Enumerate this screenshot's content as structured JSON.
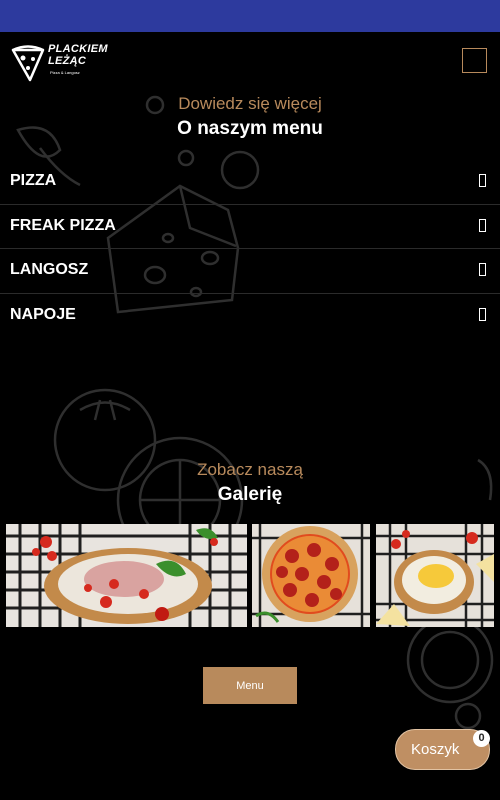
{
  "header": {
    "logo_title_line1": "PLACKIEM",
    "logo_title_line2": "LEŻĄC",
    "logo_subtitle": "Pizza & Langosz",
    "menu_toggle_icon": "",
    "menu_toggle_icon_name": "menu-icon"
  },
  "menu_section": {
    "subtitle": "Dowiedz się więcej",
    "title": "O naszym menu",
    "items": [
      {
        "label": "PIZZA",
        "arrow": ""
      },
      {
        "label": "FREAK PIZZA",
        "arrow": ""
      },
      {
        "label": "LANGOSZ",
        "arrow": ""
      },
      {
        "label": "NAPOJE",
        "arrow": ""
      }
    ]
  },
  "gallery_section": {
    "subtitle": "Zobacz naszą",
    "title": "Galerię"
  },
  "menu_button": {
    "label": "Menu"
  },
  "cart": {
    "label": "Koszyk",
    "icon": "",
    "count": "0"
  },
  "colors": {
    "accent": "#b88a5c",
    "background": "#000000",
    "status_bar": "#2d3a9e",
    "text": "#ffffff"
  }
}
